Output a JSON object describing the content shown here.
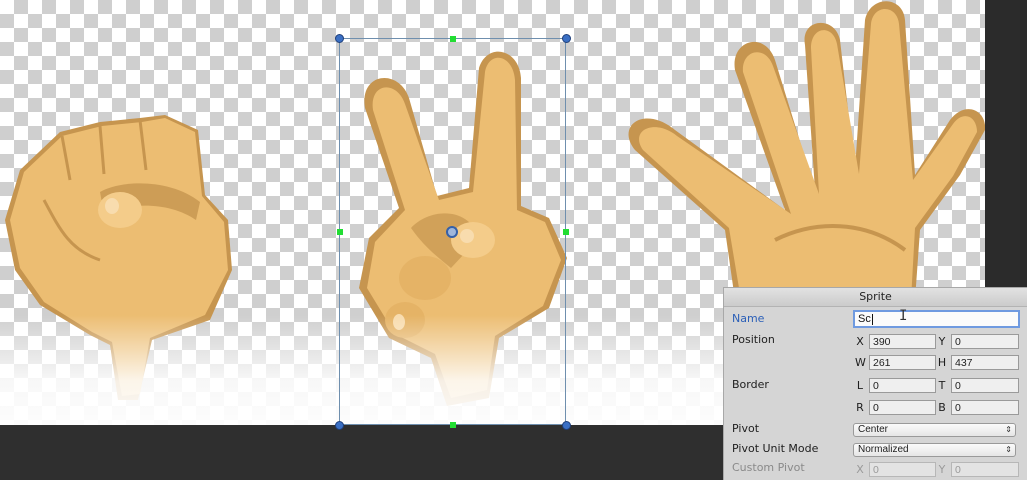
{
  "panel": {
    "title": "Sprite",
    "name_label": "Name",
    "name_value": "Sc",
    "position_label": "Position",
    "x_axis": "X",
    "x_value": "390",
    "y_axis": "Y",
    "y_value": "0",
    "w_axis": "W",
    "w_value": "261",
    "h_axis": "H",
    "h_value": "437",
    "border_label": "Border",
    "l_axis": "L",
    "l_value": "0",
    "t_axis": "T",
    "t_value": "0",
    "r_axis": "R",
    "r_value": "0",
    "b_axis": "B",
    "b_value": "0",
    "pivot_label": "Pivot",
    "pivot_value": "Center",
    "pivot_unit_label": "Pivot Unit Mode",
    "pivot_unit_value": "Normalized",
    "custom_pivot_label": "Custom Pivot",
    "cx_axis": "X",
    "cx_value": "0",
    "cy_axis": "Y",
    "cy_value": "0"
  },
  "icons": {
    "ibeam": "I",
    "dropdown": "⇕"
  },
  "colors": {
    "skin": "#ecbd72",
    "skin_shadow": "#c6954f",
    "selection_handle": "#3a6fc4",
    "mid_handle": "#22dd33",
    "name_label": "#2b5fb8"
  }
}
